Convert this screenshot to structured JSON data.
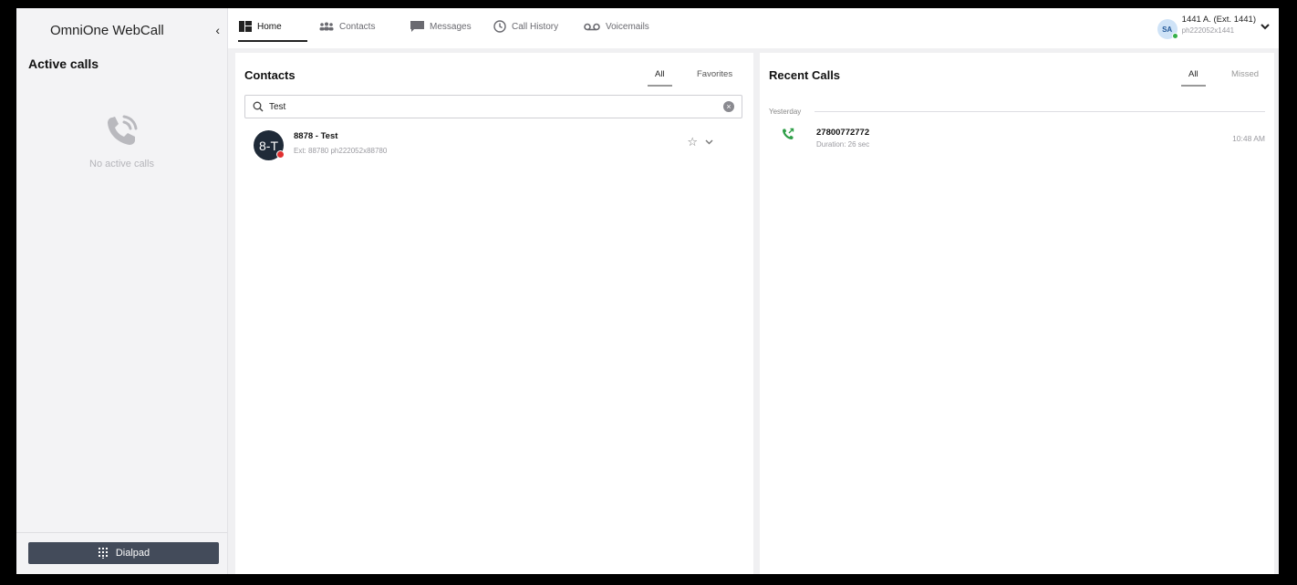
{
  "app": {
    "title": "OmniOne WebCall",
    "collapse_glyph": "‹"
  },
  "sidebar": {
    "active_calls_title": "Active calls",
    "no_active_calls": "No active calls",
    "dialpad_label": "Dialpad"
  },
  "nav": {
    "items": [
      {
        "label": "Home",
        "icon": "home-icon",
        "active": true
      },
      {
        "label": "Contacts",
        "icon": "contacts-icon",
        "active": false
      },
      {
        "label": "Messages",
        "icon": "messages-icon",
        "active": false
      },
      {
        "label": "Call History",
        "icon": "history-icon",
        "active": false
      },
      {
        "label": "Voicemails",
        "icon": "voicemail-icon",
        "active": false
      }
    ]
  },
  "user": {
    "initials": "SA",
    "name": "1441 A. (Ext. 1441)",
    "id": "ph222052x1441",
    "status_color": "#35b04a"
  },
  "contacts": {
    "title": "Contacts",
    "tabs": [
      {
        "label": "All",
        "active": true
      },
      {
        "label": "Favorites",
        "active": false
      }
    ],
    "search": {
      "value": "Test"
    },
    "items": [
      {
        "initials": "8-T",
        "name": "8878 - Test",
        "sub": "Ext: 88780  ph222052x88780",
        "status_color": "#e03030"
      }
    ]
  },
  "recent": {
    "title": "Recent Calls",
    "tabs": [
      {
        "label": "All",
        "active": true
      },
      {
        "label": "Missed",
        "active": false
      }
    ],
    "groups": [
      {
        "day": "Yesterday",
        "calls": [
          {
            "number": "27800772772",
            "duration": "Duration: 26 sec",
            "time": "10:48 AM",
            "type": "outgoing"
          }
        ]
      }
    ]
  },
  "colors": {
    "accent_dark": "#434b5a",
    "call_green": "#2e9e47"
  }
}
